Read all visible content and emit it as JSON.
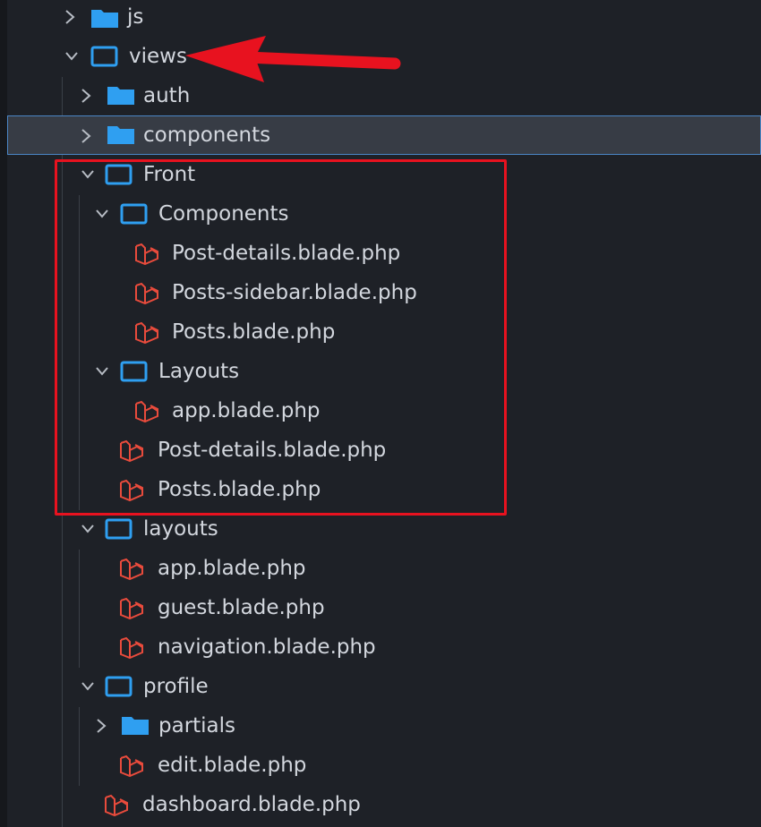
{
  "tree": {
    "js": {
      "label": "js"
    },
    "views": {
      "label": "views"
    },
    "auth": {
      "label": "auth"
    },
    "components": {
      "label": "components"
    },
    "front": {
      "label": "Front"
    },
    "front_components": {
      "label": "Components"
    },
    "front_components_post_details": {
      "label": "Post-details.blade.php"
    },
    "front_components_posts_sidebar": {
      "label": "Posts-sidebar.blade.php"
    },
    "front_components_posts": {
      "label": "Posts.blade.php"
    },
    "front_layouts": {
      "label": "Layouts"
    },
    "front_layouts_app": {
      "label": "app.blade.php"
    },
    "front_post_details": {
      "label": "Post-details.blade.php"
    },
    "front_posts": {
      "label": "Posts.blade.php"
    },
    "layouts": {
      "label": "layouts"
    },
    "layouts_app": {
      "label": "app.blade.php"
    },
    "layouts_guest": {
      "label": "guest.blade.php"
    },
    "layouts_navigation": {
      "label": "navigation.blade.php"
    },
    "profile": {
      "label": "profile"
    },
    "profile_partials": {
      "label": "partials"
    },
    "profile_edit": {
      "label": "edit.blade.php"
    },
    "dashboard": {
      "label": "dashboard.blade.php"
    }
  },
  "colors": {
    "background": "#1e2127",
    "selected_row": "#373c45",
    "selection_border": "#4b85c5",
    "folder_icon": "#2f9ff1",
    "blade_icon": "#e94b3c",
    "annotation_red": "#e8121f"
  },
  "icons": {
    "collapsed": "chevron-right-icon",
    "expanded": "chevron-down-icon",
    "closed_folder": "folder-filled-icon",
    "open_folder": "folder-open-icon",
    "blade_file": "laravel-blade-icon"
  }
}
